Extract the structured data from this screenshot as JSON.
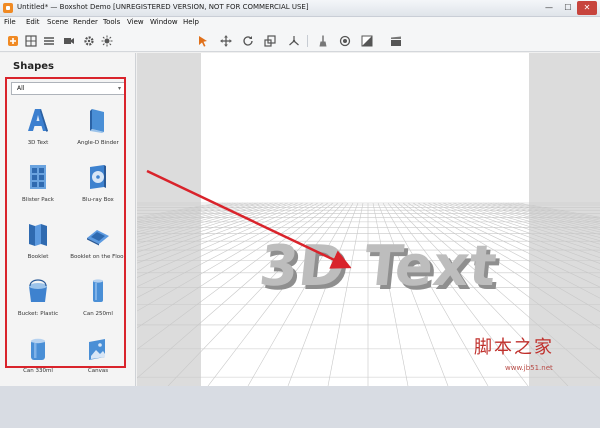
{
  "window": {
    "title": "Untitled* — Boxshot Demo [UNREGISTERED VERSION, NOT FOR COMMERCIAL USE]",
    "minimize_label": "—",
    "maximize_label": "☐",
    "close_label": "✕"
  },
  "menu": {
    "items": [
      "File",
      "Edit",
      "Scene",
      "Render",
      "Tools",
      "View",
      "Window",
      "Help"
    ]
  },
  "toolbar": {
    "icons": [
      "add-icon",
      "grid-icon",
      "list-icon",
      "camera-icon",
      "gear-icon",
      "light-icon",
      "select-arrow-icon",
      "move-icon",
      "rotate-icon",
      "scale-icon",
      "axes-icon",
      "broom-icon",
      "target-icon",
      "contrast-icon",
      "clapperboard-icon"
    ]
  },
  "sidebar": {
    "title": "Shapes",
    "filter": {
      "selected": "All"
    },
    "shapes": [
      {
        "label": "3D Text",
        "icon": "3d-text-icon"
      },
      {
        "label": "Angle-D Binder",
        "icon": "binder-icon"
      },
      {
        "label": "Blister Pack",
        "icon": "blister-pack-icon"
      },
      {
        "label": "Blu-ray Box",
        "icon": "bluray-box-icon"
      },
      {
        "label": "Booklet",
        "icon": "booklet-icon"
      },
      {
        "label": "Booklet on the Floor",
        "icon": "booklet-floor-icon"
      },
      {
        "label": "Bucket: Plastic",
        "icon": "bucket-icon"
      },
      {
        "label": "Can 250ml",
        "icon": "can-icon"
      },
      {
        "label": "Can 330ml",
        "icon": "can-icon"
      },
      {
        "label": "Canvas",
        "icon": "canvas-icon"
      }
    ]
  },
  "viewport": {
    "scene_text": "3D Text"
  },
  "watermark": {
    "main": "脚本之家",
    "sub": "www.jb51.net"
  },
  "colors": {
    "annotation_red": "#d9232b",
    "accent_orange": "#f08a24",
    "icon_blue": "#4a8fd6"
  }
}
